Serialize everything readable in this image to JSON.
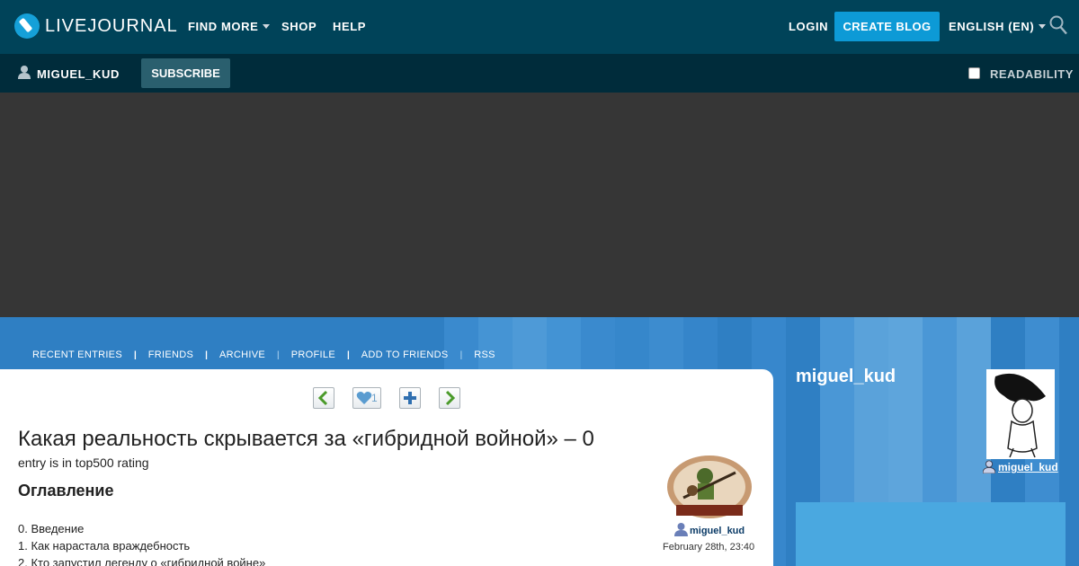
{
  "topbar": {
    "logo_text": "LIVEJOURNAL",
    "nav": [
      {
        "label": "FIND MORE"
      },
      {
        "label": "SHOP"
      },
      {
        "label": "HELP"
      }
    ],
    "login_label": "LOGIN",
    "create_blog_label": "CREATE BLOG",
    "language_label": "ENGLISH (EN)"
  },
  "subbar": {
    "username": "MIGUEL_KUD",
    "subscribe_label": "SUBSCRIBE",
    "readability_label": "READABILITY",
    "readability_checked": false
  },
  "blog_nav": [
    {
      "label": "RECENT ENTRIES"
    },
    {
      "label": "FRIENDS"
    },
    {
      "label": "ARCHIVE"
    },
    {
      "label": "PROFILE"
    },
    {
      "label": "ADD TO FRIENDS"
    },
    {
      "label": "RSS"
    }
  ],
  "post": {
    "like_count": "1",
    "title": "Какая реальность скрывается за «гибридной войной» – 0",
    "rating_note": "entry is in top500 rating",
    "toc_heading": "Оглавление",
    "toc": [
      "0. Введение",
      "1. Как нарастала враждебность",
      "2. Кто запустил легенду о «гибридной войне»"
    ],
    "author": "miguel_kud",
    "date": "February 28th, 23:40"
  },
  "sidebar": {
    "blog_name": "miguel_kud",
    "user_link": "miguel_kud"
  },
  "colors": {
    "topbar": "#004359",
    "subbar": "#002c3b",
    "accent": "#0d9ad6",
    "banner": "#363636",
    "blog_bg": "#2f7fc3"
  }
}
